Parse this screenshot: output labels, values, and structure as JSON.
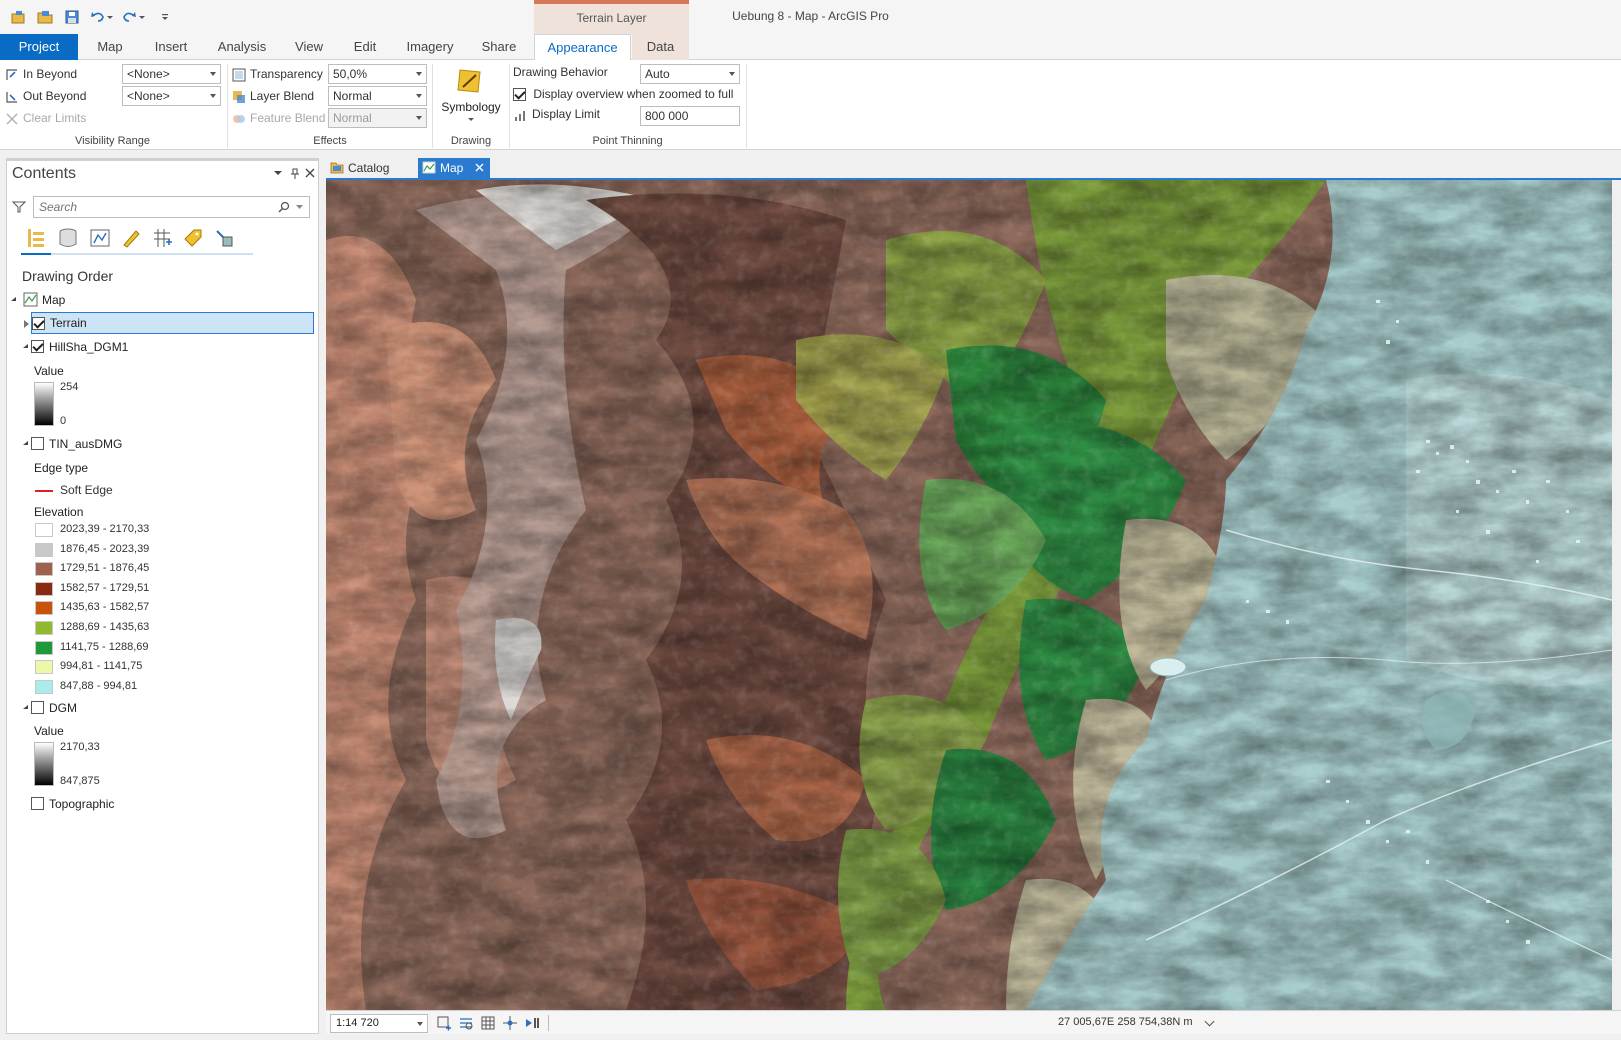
{
  "app": {
    "title": "Uebung 8 - Map - ArcGIS Pro",
    "context_tab_group": "Terrain Layer"
  },
  "ribbon_tabs": [
    "Project",
    "Map",
    "Insert",
    "Analysis",
    "View",
    "Edit",
    "Imagery",
    "Share",
    "Appearance",
    "Data"
  ],
  "ribbon": {
    "visibility_range": {
      "label": "Visibility Range",
      "in_beyond": "In Beyond",
      "out_beyond": "Out Beyond",
      "clear_limits": "Clear Limits",
      "in_beyond_value": "<None>",
      "out_beyond_value": "<None>"
    },
    "effects": {
      "label": "Effects",
      "transparency": "Transparency",
      "transparency_value": "50,0%",
      "layer_blend": "Layer Blend",
      "layer_blend_value": "Normal",
      "feature_blend": "Feature Blend",
      "feature_blend_value": "Normal"
    },
    "drawing": {
      "label": "Drawing",
      "symbology": "Symbology"
    },
    "point_thinning": {
      "label": "Point Thinning",
      "drawing_behavior": "Drawing Behavior",
      "drawing_behavior_value": "Auto",
      "display_overview": "Display overview when zoomed to full",
      "display_overview_checked": true,
      "display_limit": "Display Limit",
      "display_limit_value": "800 000"
    }
  },
  "contents": {
    "title": "Contents",
    "search_placeholder": "Search",
    "drawing_order": "Drawing Order",
    "map_label": "Map",
    "layers": {
      "terrain": {
        "name": "Terrain",
        "checked": true,
        "selected": true
      },
      "hillshade": {
        "name": "HillSha_DGM1",
        "checked": true,
        "legend_title": "Value",
        "max": "254",
        "min": "0"
      },
      "tin": {
        "name": "TIN_ausDMG",
        "checked": false,
        "edge_title": "Edge type",
        "edge_label": "Soft Edge",
        "elevation_title": "Elevation",
        "classes": [
          {
            "label": "2023,39 - 2170,33",
            "color": "#ffffff"
          },
          {
            "label": "1876,45 - 2023,39",
            "color": "#c8c8c8"
          },
          {
            "label": "1729,51 - 1876,45",
            "color": "#a0604e"
          },
          {
            "label": "1582,57 - 1729,51",
            "color": "#8a2a10"
          },
          {
            "label": "1435,63 - 1582,57",
            "color": "#c8520a"
          },
          {
            "label": "1288,69 - 1435,63",
            "color": "#8fba2e"
          },
          {
            "label": "1141,75 - 1288,69",
            "color": "#1f9a3a"
          },
          {
            "label": "994,81 - 1141,75",
            "color": "#eef7a8"
          },
          {
            "label": "847,88 - 994,81",
            "color": "#a8ecec"
          }
        ]
      },
      "dgm": {
        "name": "DGM",
        "checked": false,
        "legend_title": "Value",
        "max": "2170,33",
        "min": "847,875"
      },
      "topographic": {
        "name": "Topographic",
        "checked": false
      }
    }
  },
  "view_tabs": {
    "catalog": "Catalog",
    "map": "Map"
  },
  "status": {
    "scale": "1:14 720",
    "coordinates": "27 005,67E 258 754,38N m"
  }
}
